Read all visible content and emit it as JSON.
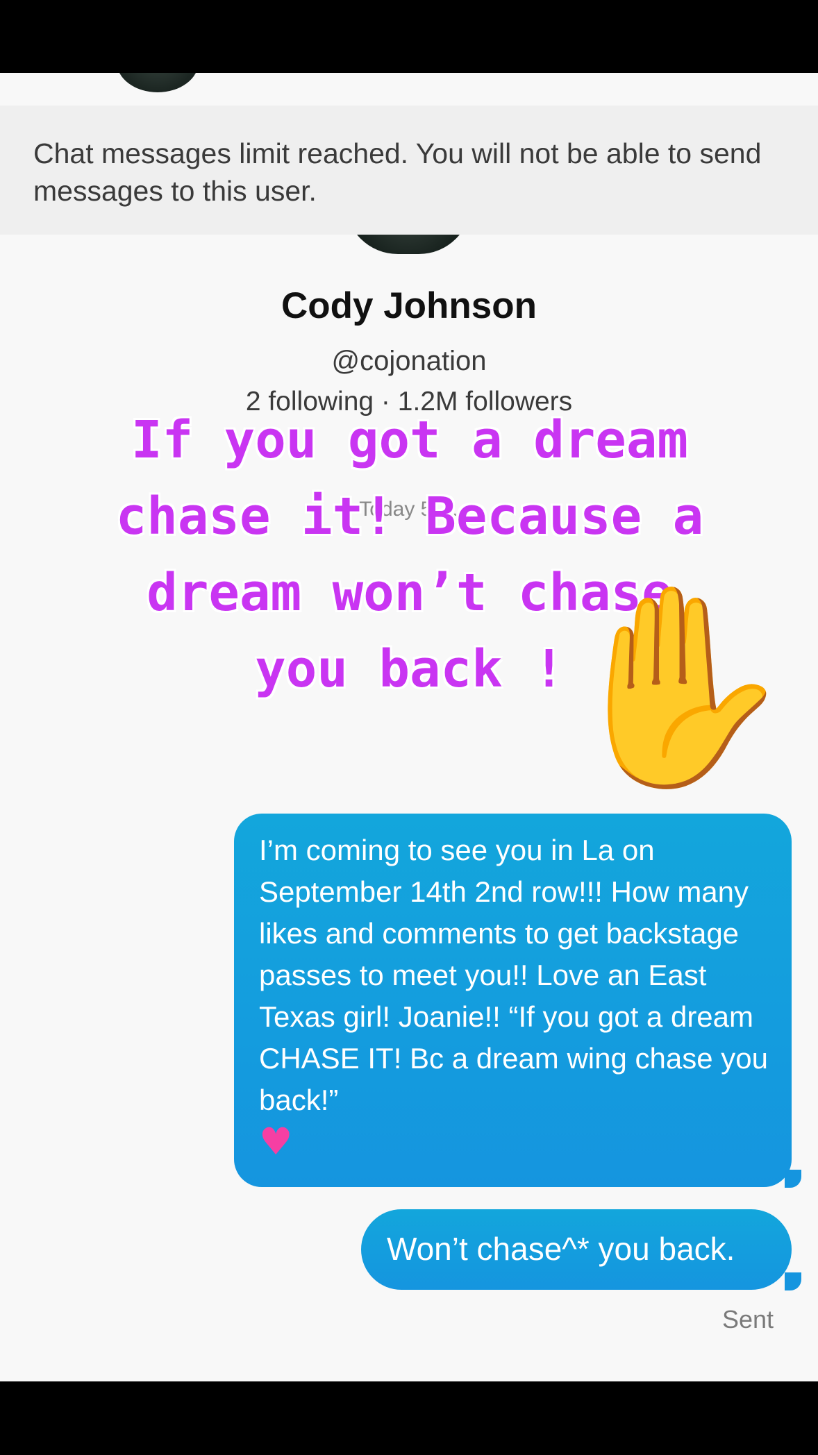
{
  "banner": {
    "limit_message": "Chat messages limit reached. You will not be able to send messages to this user."
  },
  "profile": {
    "name": "Cody Johnson",
    "handle": "@cojonation",
    "stats": "2 following · 1.2M followers",
    "timestamp": "Today 5:…"
  },
  "overlay": {
    "lines": [
      "If you got a dream",
      "chase it! Because a",
      "dream won’t chase",
      "you back !"
    ],
    "emoji_icon": "waving-hand-icon"
  },
  "messages": [
    {
      "text": "I’m coming to see you in La on September 14th 2nd row!!! How many likes and comments to get backstage passes to meet you!! Love an East Texas girl! Joanie!! “If you got a dream CHASE IT! Bc a dream wing chase you back!”",
      "emoji_icon": "pink-heart-icon"
    },
    {
      "text": "Won’t chase^* you back."
    }
  ],
  "status": {
    "sent_label": "Sent"
  },
  "colors": {
    "bubble": "#1595df",
    "overlay_text": "#c935f2",
    "background": "#f8f8f8",
    "banner": "#efefef"
  }
}
